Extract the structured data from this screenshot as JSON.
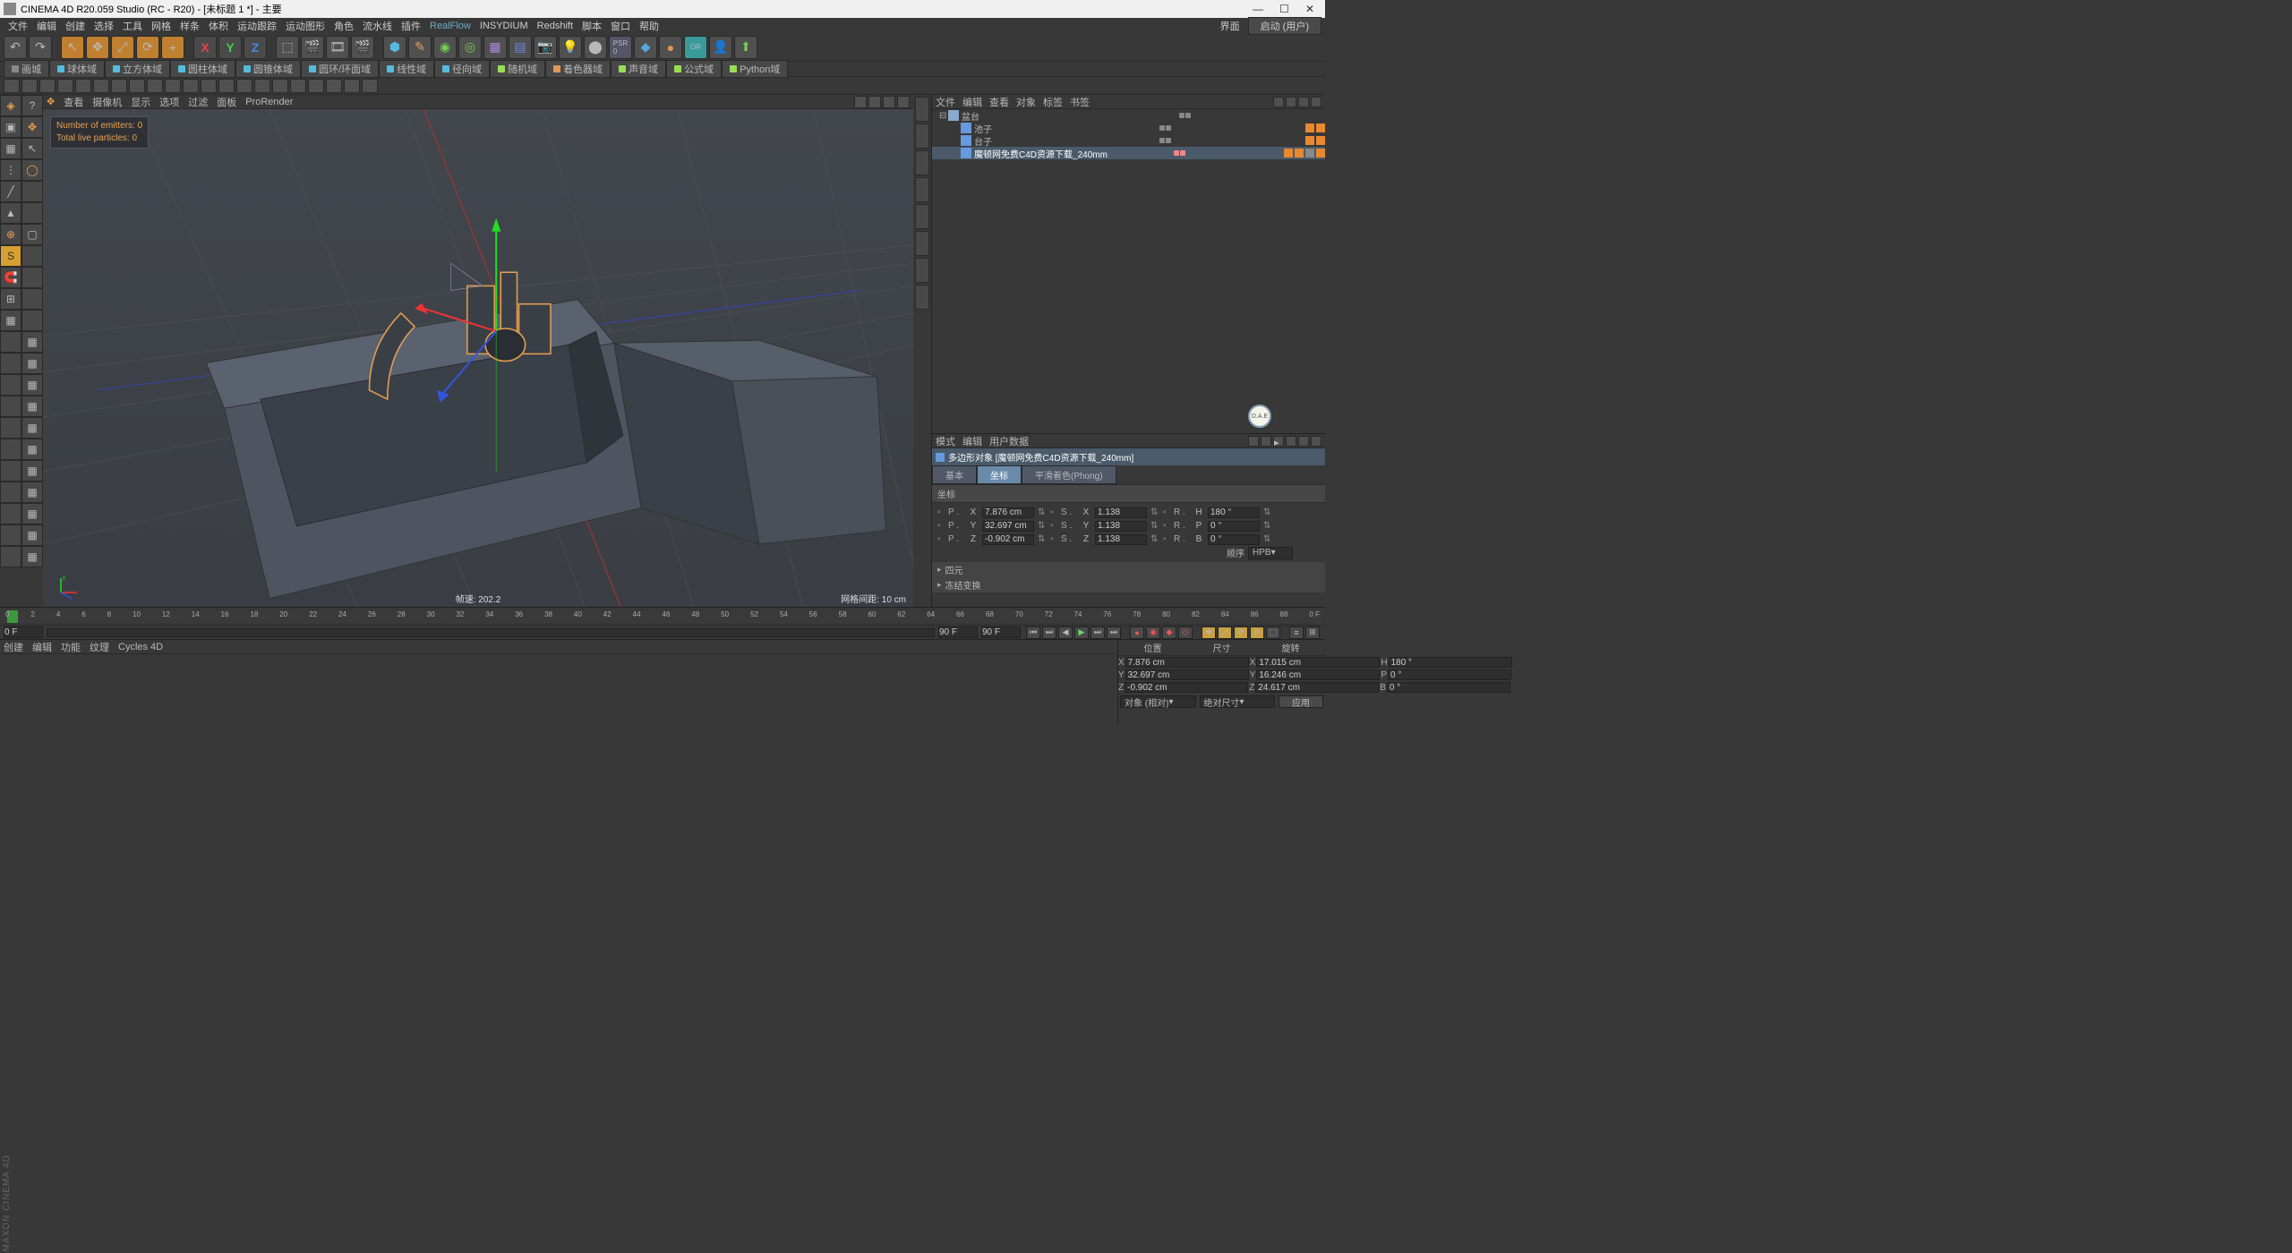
{
  "title": "CINEMA 4D R20.059 Studio (RC - R20) - [未标题 1 *] - 主要",
  "menu": [
    "文件",
    "编辑",
    "创建",
    "选择",
    "工具",
    "网格",
    "样条",
    "体积",
    "运动跟踪",
    "运动图形",
    "角色",
    "流水线",
    "插件",
    "RealFlow",
    "INSYDIUM",
    "Redshift",
    "脚本",
    "窗口",
    "帮助"
  ],
  "menu_right": {
    "label": "界面",
    "value": "启动 (用户)"
  },
  "tabs2": [
    "画城",
    "球体域",
    "立方体域",
    "圆柱体域",
    "圆锥体域",
    "圆环/环面域",
    "线性域",
    "径向域",
    "随机域",
    "着色器域",
    "声音域",
    "公式域",
    "Python域"
  ],
  "view_menu": [
    "查看",
    "摄像机",
    "显示",
    "选项",
    "过滤",
    "面板",
    "ProRender"
  ],
  "overlay": {
    "emitters": "Number of emitters: 0",
    "particles": "Total live particles: 0"
  },
  "status3d_left": "帧速: 202.2",
  "status3d_right": "网格间距: 10 cm",
  "obj_menu": [
    "文件",
    "编辑",
    "查看",
    "对象",
    "标签",
    "书签"
  ],
  "objects": [
    {
      "name": "盆台",
      "indent": 0,
      "icon": "#88aacc",
      "exp": "⊟"
    },
    {
      "name": "池子",
      "indent": 1,
      "icon": "#6699dd",
      "exp": ""
    },
    {
      "name": "台子",
      "indent": 1,
      "icon": "#6699dd",
      "exp": ""
    },
    {
      "name": "魔顿网免费C4D资源下载_240mm",
      "indent": 1,
      "icon": "#6699dd",
      "exp": "",
      "sel": true
    }
  ],
  "attr_menu": [
    "模式",
    "编辑",
    "用户数据"
  ],
  "attr_title": "多边形对象 [魔顿网免费C4D资源下载_240mm]",
  "attr_tabs": [
    "基本",
    "坐标",
    "平滑着色(Phong)"
  ],
  "attr_tab_active": 1,
  "attr_section": "坐标",
  "coords": {
    "P": {
      "X": "7.876 cm",
      "Y": "32.697 cm",
      "Z": "-0.902 cm"
    },
    "S": {
      "X": "1.138",
      "Y": "1.138",
      "Z": "1.138"
    },
    "R": {
      "H": "180 °",
      "P": "0 °",
      "B": "0 °"
    }
  },
  "order": {
    "label": "顺序",
    "value": "HPB"
  },
  "attr_collapses": [
    "四元",
    "冻结变换"
  ],
  "timeline": {
    "start": "0 F",
    "end": "90 F",
    "range_end": "90 F",
    "current": "0 F",
    "ticks": [
      "0",
      "2",
      "4",
      "6",
      "8",
      "10",
      "12",
      "14",
      "16",
      "18",
      "20",
      "22",
      "24",
      "26",
      "28",
      "30",
      "32",
      "34",
      "36",
      "38",
      "40",
      "42",
      "44",
      "46",
      "48",
      "50",
      "52",
      "54",
      "56",
      "58",
      "60",
      "62",
      "64",
      "66",
      "68",
      "70",
      "72",
      "74",
      "76",
      "78",
      "80",
      "82",
      "84",
      "86",
      "88",
      "0 F"
    ]
  },
  "mat_menu": [
    "创建",
    "编辑",
    "功能",
    "纹理",
    "Cycles 4D"
  ],
  "coord_panel": {
    "heads": [
      "位置",
      "尺寸",
      "旋转"
    ],
    "rows": [
      {
        "l": "X",
        "p": "7.876 cm",
        "s": "17.015 cm",
        "r": "180 °",
        "rl": "H"
      },
      {
        "l": "Y",
        "p": "32.697 cm",
        "s": "16.246 cm",
        "r": "0 °",
        "rl": "P"
      },
      {
        "l": "Z",
        "p": "-0.902 cm",
        "s": "24.617 cm",
        "r": "0 °",
        "rl": "B"
      }
    ],
    "mode1": "对象 (相对)",
    "mode2": "绝对尺寸",
    "apply": "应用"
  },
  "brand": "MAXON CINEMA 4D",
  "badge": "D.A.E"
}
